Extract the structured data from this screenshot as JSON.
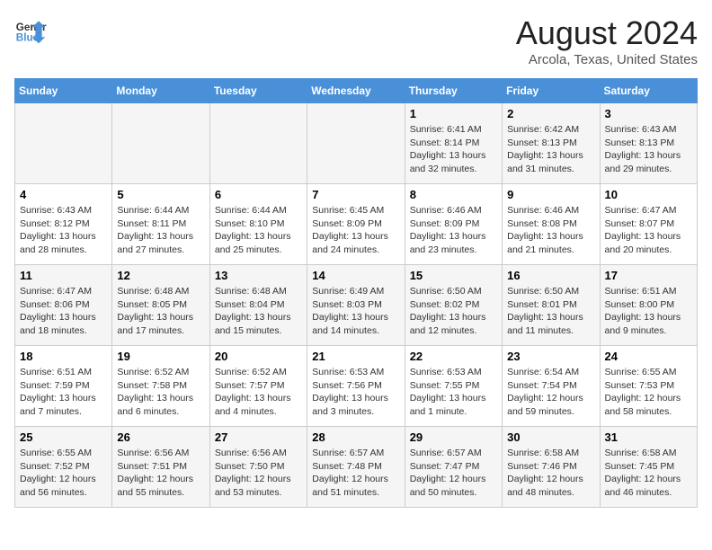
{
  "header": {
    "logo_line1": "General",
    "logo_line2": "Blue",
    "title": "August 2024",
    "subtitle": "Arcola, Texas, United States"
  },
  "weekdays": [
    "Sunday",
    "Monday",
    "Tuesday",
    "Wednesday",
    "Thursday",
    "Friday",
    "Saturday"
  ],
  "weeks": [
    [
      {
        "day": "",
        "info": ""
      },
      {
        "day": "",
        "info": ""
      },
      {
        "day": "",
        "info": ""
      },
      {
        "day": "",
        "info": ""
      },
      {
        "day": "1",
        "info": "Sunrise: 6:41 AM\nSunset: 8:14 PM\nDaylight: 13 hours\nand 32 minutes."
      },
      {
        "day": "2",
        "info": "Sunrise: 6:42 AM\nSunset: 8:13 PM\nDaylight: 13 hours\nand 31 minutes."
      },
      {
        "day": "3",
        "info": "Sunrise: 6:43 AM\nSunset: 8:13 PM\nDaylight: 13 hours\nand 29 minutes."
      }
    ],
    [
      {
        "day": "4",
        "info": "Sunrise: 6:43 AM\nSunset: 8:12 PM\nDaylight: 13 hours\nand 28 minutes."
      },
      {
        "day": "5",
        "info": "Sunrise: 6:44 AM\nSunset: 8:11 PM\nDaylight: 13 hours\nand 27 minutes."
      },
      {
        "day": "6",
        "info": "Sunrise: 6:44 AM\nSunset: 8:10 PM\nDaylight: 13 hours\nand 25 minutes."
      },
      {
        "day": "7",
        "info": "Sunrise: 6:45 AM\nSunset: 8:09 PM\nDaylight: 13 hours\nand 24 minutes."
      },
      {
        "day": "8",
        "info": "Sunrise: 6:46 AM\nSunset: 8:09 PM\nDaylight: 13 hours\nand 23 minutes."
      },
      {
        "day": "9",
        "info": "Sunrise: 6:46 AM\nSunset: 8:08 PM\nDaylight: 13 hours\nand 21 minutes."
      },
      {
        "day": "10",
        "info": "Sunrise: 6:47 AM\nSunset: 8:07 PM\nDaylight: 13 hours\nand 20 minutes."
      }
    ],
    [
      {
        "day": "11",
        "info": "Sunrise: 6:47 AM\nSunset: 8:06 PM\nDaylight: 13 hours\nand 18 minutes."
      },
      {
        "day": "12",
        "info": "Sunrise: 6:48 AM\nSunset: 8:05 PM\nDaylight: 13 hours\nand 17 minutes."
      },
      {
        "day": "13",
        "info": "Sunrise: 6:48 AM\nSunset: 8:04 PM\nDaylight: 13 hours\nand 15 minutes."
      },
      {
        "day": "14",
        "info": "Sunrise: 6:49 AM\nSunset: 8:03 PM\nDaylight: 13 hours\nand 14 minutes."
      },
      {
        "day": "15",
        "info": "Sunrise: 6:50 AM\nSunset: 8:02 PM\nDaylight: 13 hours\nand 12 minutes."
      },
      {
        "day": "16",
        "info": "Sunrise: 6:50 AM\nSunset: 8:01 PM\nDaylight: 13 hours\nand 11 minutes."
      },
      {
        "day": "17",
        "info": "Sunrise: 6:51 AM\nSunset: 8:00 PM\nDaylight: 13 hours\nand 9 minutes."
      }
    ],
    [
      {
        "day": "18",
        "info": "Sunrise: 6:51 AM\nSunset: 7:59 PM\nDaylight: 13 hours\nand 7 minutes."
      },
      {
        "day": "19",
        "info": "Sunrise: 6:52 AM\nSunset: 7:58 PM\nDaylight: 13 hours\nand 6 minutes."
      },
      {
        "day": "20",
        "info": "Sunrise: 6:52 AM\nSunset: 7:57 PM\nDaylight: 13 hours\nand 4 minutes."
      },
      {
        "day": "21",
        "info": "Sunrise: 6:53 AM\nSunset: 7:56 PM\nDaylight: 13 hours\nand 3 minutes."
      },
      {
        "day": "22",
        "info": "Sunrise: 6:53 AM\nSunset: 7:55 PM\nDaylight: 13 hours\nand 1 minute."
      },
      {
        "day": "23",
        "info": "Sunrise: 6:54 AM\nSunset: 7:54 PM\nDaylight: 12 hours\nand 59 minutes."
      },
      {
        "day": "24",
        "info": "Sunrise: 6:55 AM\nSunset: 7:53 PM\nDaylight: 12 hours\nand 58 minutes."
      }
    ],
    [
      {
        "day": "25",
        "info": "Sunrise: 6:55 AM\nSunset: 7:52 PM\nDaylight: 12 hours\nand 56 minutes."
      },
      {
        "day": "26",
        "info": "Sunrise: 6:56 AM\nSunset: 7:51 PM\nDaylight: 12 hours\nand 55 minutes."
      },
      {
        "day": "27",
        "info": "Sunrise: 6:56 AM\nSunset: 7:50 PM\nDaylight: 12 hours\nand 53 minutes."
      },
      {
        "day": "28",
        "info": "Sunrise: 6:57 AM\nSunset: 7:48 PM\nDaylight: 12 hours\nand 51 minutes."
      },
      {
        "day": "29",
        "info": "Sunrise: 6:57 AM\nSunset: 7:47 PM\nDaylight: 12 hours\nand 50 minutes."
      },
      {
        "day": "30",
        "info": "Sunrise: 6:58 AM\nSunset: 7:46 PM\nDaylight: 12 hours\nand 48 minutes."
      },
      {
        "day": "31",
        "info": "Sunrise: 6:58 AM\nSunset: 7:45 PM\nDaylight: 12 hours\nand 46 minutes."
      }
    ]
  ]
}
